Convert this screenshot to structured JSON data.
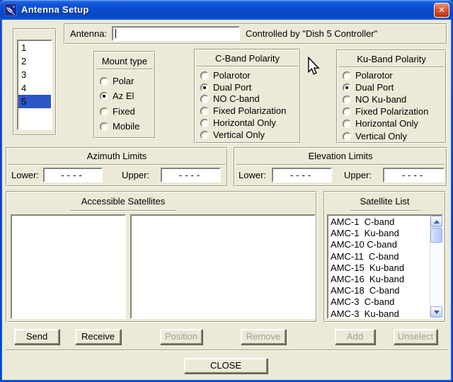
{
  "window": {
    "title": "Antenna Setup",
    "close_glyph": "✕"
  },
  "antenna": {
    "label": "Antenna:",
    "value": "",
    "controlled_by": "Controlled by \"Dish 5 Controller\""
  },
  "antenna_list": {
    "items": [
      "1",
      "2",
      "3",
      "4",
      "5"
    ],
    "selected": "5"
  },
  "mount_type": {
    "title": "Mount type",
    "options": [
      {
        "label": "Polar",
        "selected": false
      },
      {
        "label": "Az El",
        "selected": true
      },
      {
        "label": "Fixed",
        "selected": false
      },
      {
        "label": "Mobile",
        "selected": false
      }
    ]
  },
  "c_band": {
    "title": "C-Band Polarity",
    "options": [
      {
        "label": "Polarotor",
        "selected": false
      },
      {
        "label": "Dual Port",
        "selected": true
      },
      {
        "label": "NO C-band",
        "selected": false
      },
      {
        "label": "Fixed Polarization",
        "selected": false
      },
      {
        "label": "Horizontal Only",
        "selected": false
      },
      {
        "label": "Vertical Only",
        "selected": false
      }
    ]
  },
  "ku_band": {
    "title": "Ku-Band Polarity",
    "options": [
      {
        "label": "Polarotor",
        "selected": false
      },
      {
        "label": "Dual Port",
        "selected": true
      },
      {
        "label": "NO Ku-band",
        "selected": false
      },
      {
        "label": "Fixed Polarization",
        "selected": false
      },
      {
        "label": "Horizontal Only",
        "selected": false
      },
      {
        "label": "Vertical Only",
        "selected": false
      }
    ]
  },
  "azimuth_limits": {
    "title": "Azimuth Limits",
    "lower_label": "Lower:",
    "upper_label": "Upper:",
    "lower_value": "----",
    "upper_value": "----"
  },
  "elevation_limits": {
    "title": "Elevation Limits",
    "lower_label": "Lower:",
    "upper_label": "Upper:",
    "lower_value": "----",
    "upper_value": "----"
  },
  "accessible_satellites": {
    "title": "Accessible Satellites",
    "left_items": [],
    "right_items": []
  },
  "satellite_list": {
    "title": "Satellite List",
    "items": [
      "AMC-1  C-band",
      "AMC-1  Ku-band",
      "AMC-10 C-band",
      "AMC-11  C-band",
      "AMC-15  Ku-band",
      "AMC-16  Ku-band",
      "AMC-18  C-band",
      "AMC-3  C-band",
      "AMC-3  Ku-band"
    ]
  },
  "buttons": {
    "send": "Send",
    "receive": "Receive",
    "position": "Position",
    "remove": "Remove",
    "add": "Add",
    "unselect": "Unselect",
    "close": "CLOSE"
  },
  "colors": {
    "background": "#ECE9D8",
    "titlebar_blue": "#0A4ECF",
    "selection_blue": "#2C56C8",
    "close_button_red": "#D9512E",
    "disabled_text": "#A3A092"
  }
}
